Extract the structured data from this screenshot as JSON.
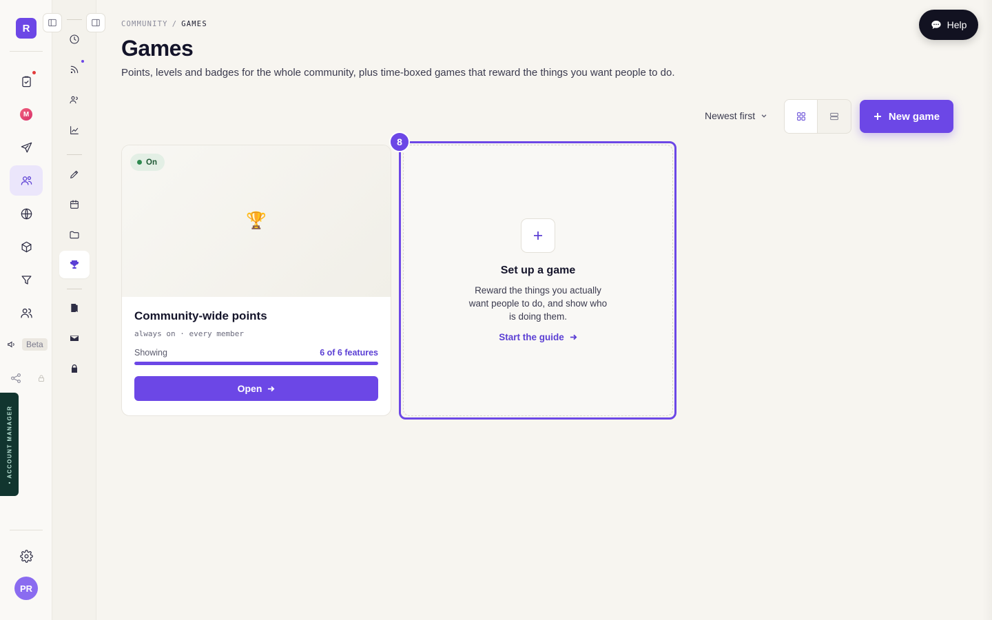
{
  "workspace": {
    "initial": "R"
  },
  "rail": {
    "items": [
      {
        "name": "tasks",
        "icon": "clipboard-check-icon",
        "notify": true
      },
      {
        "name": "mail-app",
        "icon": "m-badge-icon",
        "label": "M"
      },
      {
        "name": "send",
        "icon": "send-icon"
      },
      {
        "name": "community",
        "icon": "users-icon",
        "active": true
      },
      {
        "name": "globe",
        "icon": "globe-icon"
      },
      {
        "name": "package",
        "icon": "box-icon"
      },
      {
        "name": "filter",
        "icon": "filter-icon"
      },
      {
        "name": "people",
        "icon": "people-icon"
      }
    ],
    "beta_label": "Beta",
    "account_manager_label": "• ACCOUNT MANAGER",
    "avatar_initials": "PR"
  },
  "breadcrumb": {
    "parent": "COMMUNITY",
    "separator": "/",
    "current": "GAMES"
  },
  "page": {
    "title": "Games",
    "subtitle": "Points, levels and badges for the whole community, plus time-boxed games that reward the things you want people to do."
  },
  "help": {
    "label": "Help"
  },
  "toolbar": {
    "sort_label": "Newest first",
    "view_mode": "grid",
    "new_game_label": "New game"
  },
  "games": [
    {
      "status": "On",
      "title": "Community-wide points",
      "meta": "always on · every member",
      "showing_label": "Showing",
      "features_label": "6 of 6 features",
      "features_shown": 6,
      "features_total": 6,
      "open_label": "Open"
    }
  ],
  "setup": {
    "title": "Set up a game",
    "description": "Reward the things you actually want people to do, and show who is doing them.",
    "link_label": "Start the guide",
    "step_number": "8"
  },
  "colors": {
    "accent": "#6c47e6",
    "status_on": "#2e8a4f",
    "background": "#f7f5f0"
  }
}
